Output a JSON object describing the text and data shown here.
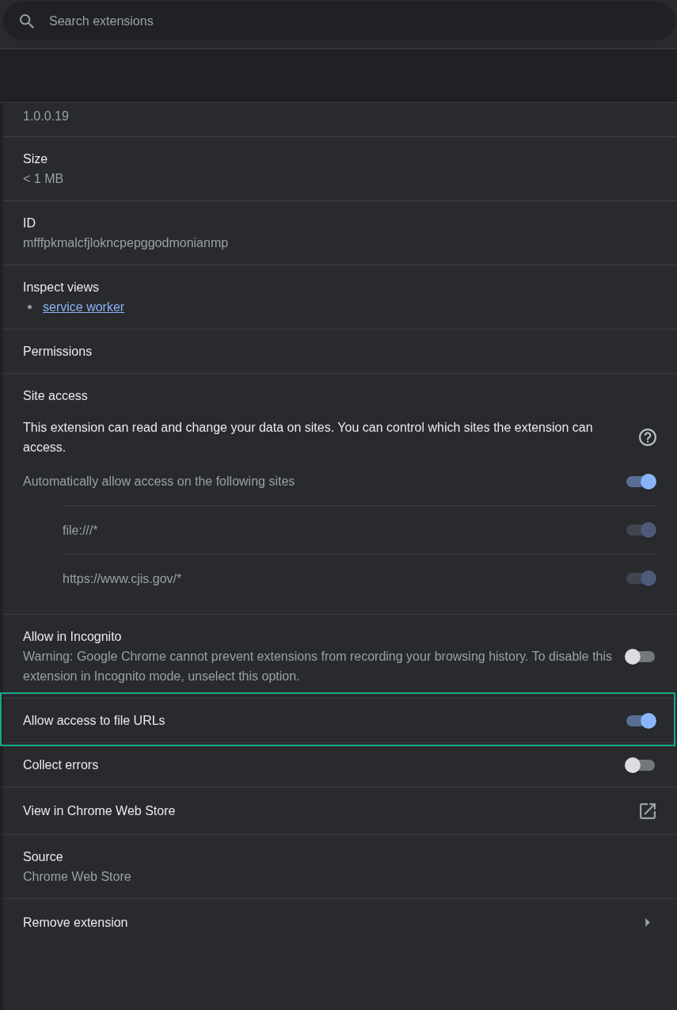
{
  "search": {
    "placeholder": "Search extensions"
  },
  "details": [
    {
      "kind": "text",
      "value": "1.0.0.19"
    },
    {
      "kind": "text",
      "label": "Size",
      "value": "< 1 MB"
    },
    {
      "kind": "text",
      "label": "ID",
      "value": "mfffpkmalcfjlokncpepggodmonianmp"
    },
    {
      "kind": "links",
      "label": "Inspect views",
      "links": [
        "service worker"
      ]
    },
    {
      "kind": "heading",
      "label": "Permissions"
    },
    {
      "kind": "site_access",
      "label": "Site access",
      "description": "This extension can read and change your data on sites. You can control which sites the extension can access.",
      "auto": {
        "label": "Automatically allow access on the following sites",
        "on": true
      },
      "sites": [
        {
          "pattern": "file:///*",
          "on": true,
          "disabled": true
        },
        {
          "pattern": "https://www.cjis.gov/*",
          "on": true,
          "disabled": true
        }
      ]
    },
    {
      "kind": "toggle",
      "label": "Allow in Incognito",
      "description": "Warning: Google Chrome cannot prevent extensions from recording your browsing history. To disable this extension in Incognito mode, unselect this option.",
      "on": false,
      "highlighted": false
    },
    {
      "kind": "toggle",
      "label": "Allow access to file URLs",
      "on": true,
      "highlighted": true
    },
    {
      "kind": "toggle",
      "label": "Collect errors",
      "on": false,
      "highlighted": false
    },
    {
      "kind": "external_link",
      "label": "View in Chrome Web Store"
    },
    {
      "kind": "text",
      "label": "Source",
      "value": "Chrome Web Store"
    },
    {
      "kind": "nav",
      "label": "Remove extension"
    }
  ]
}
